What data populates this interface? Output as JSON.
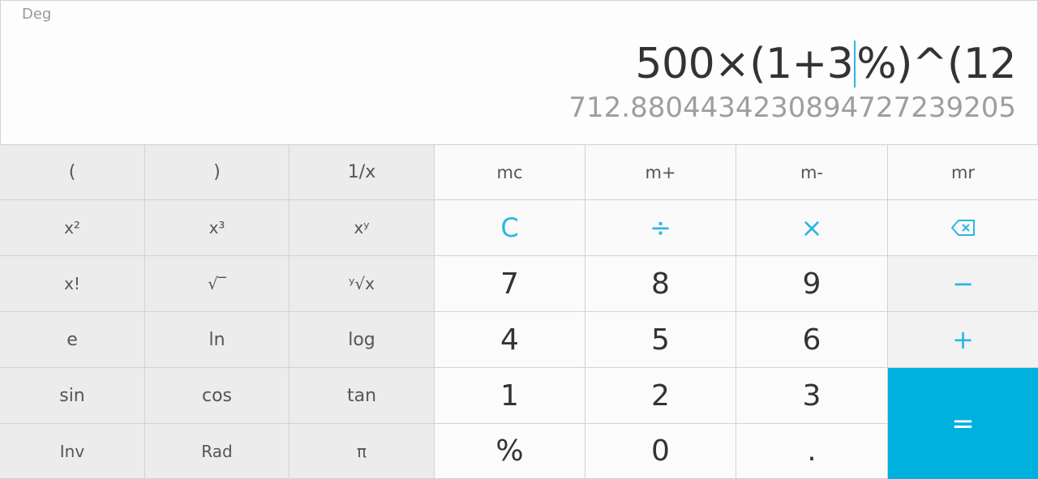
{
  "display": {
    "mode": "Deg",
    "expression_before_cursor": "500×(1+3",
    "expression_after_cursor": "%)^(12",
    "result": "712.8804434230894727239205"
  },
  "keypad": {
    "advanced": {
      "open_paren": "(",
      "close_paren": ")",
      "reciprocal": "1/x",
      "square": "x²",
      "cube": "x³",
      "power": "xʸ",
      "factorial": "x!",
      "sqrt": "√‾",
      "root": "ʸ√x",
      "e": "e",
      "ln": "ln",
      "log": "log",
      "sin": "sin",
      "cos": "cos",
      "tan": "tan",
      "inv": "Inv",
      "rad": "Rad",
      "pi": "π"
    },
    "memory": {
      "mc": "mc",
      "m_plus": "m+",
      "m_minus": "m-",
      "mr": "mr"
    },
    "operators": {
      "clear": "C",
      "divide": "÷",
      "multiply": "×",
      "minus": "−",
      "plus": "+",
      "equals": "="
    },
    "digits": {
      "d7": "7",
      "d8": "8",
      "d9": "9",
      "d4": "4",
      "d5": "5",
      "d6": "6",
      "d1": "1",
      "d2": "2",
      "d3": "3",
      "percent": "%",
      "d0": "0",
      "dot": "."
    }
  },
  "colors": {
    "accent": "#29b6e4",
    "equals_bg": "#00b1df",
    "advanced_bg": "#ececec"
  }
}
